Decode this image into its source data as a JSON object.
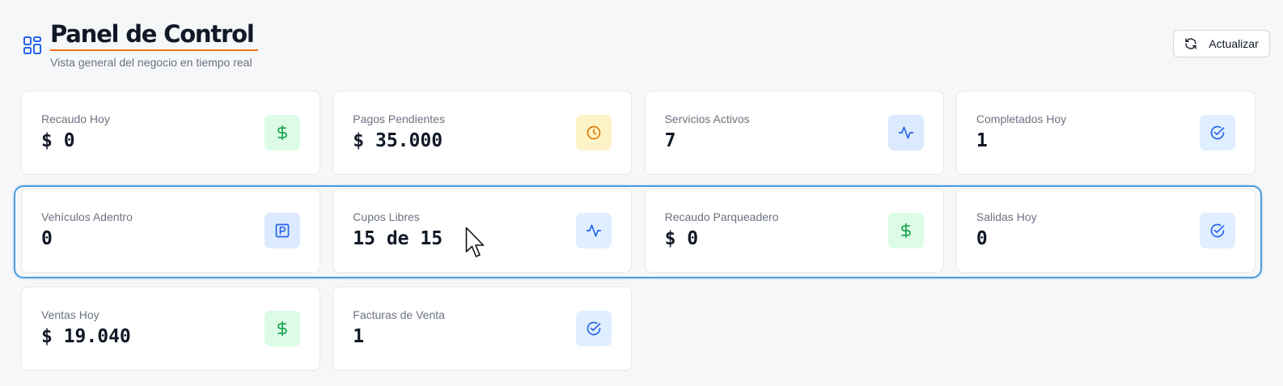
{
  "header": {
    "title": "Panel de Control",
    "subtitle": "Vista general del negocio en tiempo real",
    "refresh_label": "Actualizar"
  },
  "colors": {
    "accent_underline": "#f97316",
    "green": "#16a34a",
    "yellow": "#d97706",
    "blue": "#2563eb",
    "highlight_border": "#4a9ee0"
  },
  "cards": [
    {
      "label": "Recaudo Hoy",
      "value": "$ 0",
      "icon": "dollar-icon",
      "tone": "green"
    },
    {
      "label": "Pagos Pendientes",
      "value": "$ 35.000",
      "icon": "clock-icon",
      "tone": "yellow"
    },
    {
      "label": "Servicios Activos",
      "value": "7",
      "icon": "activity-icon",
      "tone": "blue"
    },
    {
      "label": "Completados Hoy",
      "value": "1",
      "icon": "check-circle-icon",
      "tone": "lightblue"
    },
    {
      "label": "Vehículos Adentro",
      "value": "0",
      "icon": "parking-icon",
      "tone": "blue"
    },
    {
      "label": "Cupos Libres",
      "value": "15 de 15",
      "icon": "activity-icon",
      "tone": "lightblue"
    },
    {
      "label": "Recaudo Parqueadero",
      "value": "$ 0",
      "icon": "dollar-icon",
      "tone": "green"
    },
    {
      "label": "Salidas Hoy",
      "value": "0",
      "icon": "check-circle-icon",
      "tone": "lightblue"
    },
    {
      "label": "Ventas Hoy",
      "value": "$ 19.040",
      "icon": "dollar-icon",
      "tone": "green"
    },
    {
      "label": "Facturas de Venta",
      "value": "1",
      "icon": "check-circle-icon",
      "tone": "lightblue"
    }
  ]
}
